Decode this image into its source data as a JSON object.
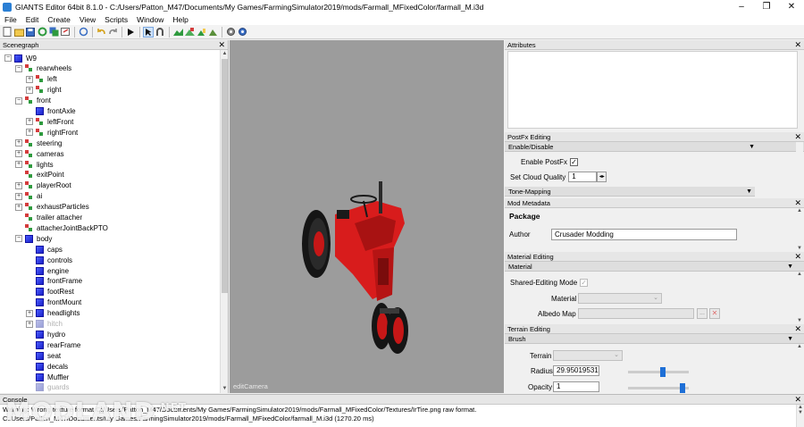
{
  "window": {
    "title": "GIANTS Editor 64bit 8.1.0 - C:/Users/Patton_M47/Documents/My Games/FarmingSimulator2019/mods/Farmall_MFixedColor/farmall_M.i3d",
    "minimize": "–",
    "maximize": "❐",
    "close": "✕"
  },
  "menu": [
    "File",
    "Edit",
    "Create",
    "View",
    "Scripts",
    "Window",
    "Help"
  ],
  "colors": {
    "accent": "#1e6fd6",
    "tractor_red": "#d81c1c",
    "viewport_bg": "#9c9c9c",
    "node_blue": "#2a33e0"
  },
  "scenegraph": {
    "title": "Scenegraph",
    "close": "✕",
    "nodes": [
      {
        "label": "W9",
        "depth": 0,
        "exp": "−",
        "icon": "cube",
        "faded": false
      },
      {
        "label": "rearwheels",
        "depth": 1,
        "exp": "−",
        "icon": "group",
        "faded": false
      },
      {
        "label": "left",
        "depth": 2,
        "exp": "+",
        "icon": "group",
        "faded": false
      },
      {
        "label": "right",
        "depth": 2,
        "exp": "+",
        "icon": "group",
        "faded": false
      },
      {
        "label": "front",
        "depth": 1,
        "exp": "−",
        "icon": "group",
        "faded": false
      },
      {
        "label": "frontAxle",
        "depth": 2,
        "exp": "",
        "icon": "cube",
        "faded": false
      },
      {
        "label": "leftFront",
        "depth": 2,
        "exp": "+",
        "icon": "group",
        "faded": false
      },
      {
        "label": "rightFront",
        "depth": 2,
        "exp": "+",
        "icon": "group",
        "faded": false
      },
      {
        "label": "steering",
        "depth": 1,
        "exp": "+",
        "icon": "group",
        "faded": false
      },
      {
        "label": "cameras",
        "depth": 1,
        "exp": "+",
        "icon": "group",
        "faded": false
      },
      {
        "label": "lights",
        "depth": 1,
        "exp": "+",
        "icon": "group",
        "faded": false
      },
      {
        "label": "exitPoint",
        "depth": 1,
        "exp": "",
        "icon": "group",
        "faded": false
      },
      {
        "label": "playerRoot",
        "depth": 1,
        "exp": "+",
        "icon": "group",
        "faded": false
      },
      {
        "label": "ai",
        "depth": 1,
        "exp": "+",
        "icon": "group",
        "faded": false
      },
      {
        "label": "exhaustParticles",
        "depth": 1,
        "exp": "+",
        "icon": "group",
        "faded": false
      },
      {
        "label": "trailer attacher",
        "depth": 1,
        "exp": "",
        "icon": "group",
        "faded": false
      },
      {
        "label": "attacherJointBackPTO",
        "depth": 1,
        "exp": "",
        "icon": "group",
        "faded": false
      },
      {
        "label": "body",
        "depth": 1,
        "exp": "−",
        "icon": "cube",
        "faded": false
      },
      {
        "label": "caps",
        "depth": 2,
        "exp": "",
        "icon": "cube",
        "faded": false
      },
      {
        "label": "controls",
        "depth": 2,
        "exp": "",
        "icon": "cube",
        "faded": false
      },
      {
        "label": "engine",
        "depth": 2,
        "exp": "",
        "icon": "cube",
        "faded": false
      },
      {
        "label": "frontFrame",
        "depth": 2,
        "exp": "",
        "icon": "cube",
        "faded": false
      },
      {
        "label": "footRest",
        "depth": 2,
        "exp": "",
        "icon": "cube",
        "faded": false
      },
      {
        "label": "frontMount",
        "depth": 2,
        "exp": "",
        "icon": "cube",
        "faded": false
      },
      {
        "label": "headlights",
        "depth": 2,
        "exp": "+",
        "icon": "cube",
        "faded": false
      },
      {
        "label": "hitch",
        "depth": 2,
        "exp": "+",
        "icon": "cube",
        "faded": true
      },
      {
        "label": "hydro",
        "depth": 2,
        "exp": "",
        "icon": "cube",
        "faded": false
      },
      {
        "label": "rearFrame",
        "depth": 2,
        "exp": "",
        "icon": "cube",
        "faded": false
      },
      {
        "label": "seat",
        "depth": 2,
        "exp": "",
        "icon": "cube",
        "faded": false
      },
      {
        "label": "decals",
        "depth": 2,
        "exp": "",
        "icon": "cube",
        "faded": false
      },
      {
        "label": "Muffler",
        "depth": 2,
        "exp": "",
        "icon": "cube",
        "faded": false
      },
      {
        "label": "guards",
        "depth": 2,
        "exp": "",
        "icon": "cube",
        "faded": true
      }
    ]
  },
  "viewport": {
    "camera_label": "editCamera"
  },
  "attributes": {
    "title": "Attributes",
    "close": "✕"
  },
  "postfx": {
    "title": "PostFx Editing",
    "close": "✕",
    "section1": "Enable/Disable",
    "enable_label": "Enable PostFx",
    "enable_check": "✓",
    "cloud_label": "Set Cloud Quality",
    "cloud_value": "1",
    "section2": "Tone-Mapping"
  },
  "mod_metadata": {
    "title": "Mod Metadata",
    "close": "✕",
    "package_label": "Package",
    "author_label": "Author",
    "author_value": "Crusader Modding"
  },
  "material": {
    "title": "Material Editing",
    "close": "✕",
    "section": "Material",
    "shared_label": "Shared-Editing Mode",
    "shared_check": "✓",
    "material_label": "Material",
    "albedo_label": "Albedo Map",
    "browse": "...",
    "clear": "✕"
  },
  "terrain": {
    "title": "Terrain Editing",
    "close": "✕",
    "section": "Brush",
    "terrain_label": "Terrain",
    "radius_label": "Radius",
    "radius_value": "29.95019531",
    "radius_level": 0.58,
    "opacity_label": "Opacity",
    "opacity_value": "1",
    "opacity_level": 0.93
  },
  "console": {
    "title": "Console",
    "close": "✕",
    "line1": "Warning: Wrong texture format C:/Users/Patton_M47/Documents/My Games/FarmingSimulator2019/mods/Farmall_MFixedColor/Textures/IrTire.png raw format.",
    "line2": "C:/Users/Patton_M47/Documents/My Games/FarmingSimulator2019/mods/Farmall_MFixedColor/farmall_M.i3d (1270.20 ms)"
  },
  "watermark": {
    "text": "MODLAND",
    "suffix": ".NET"
  }
}
